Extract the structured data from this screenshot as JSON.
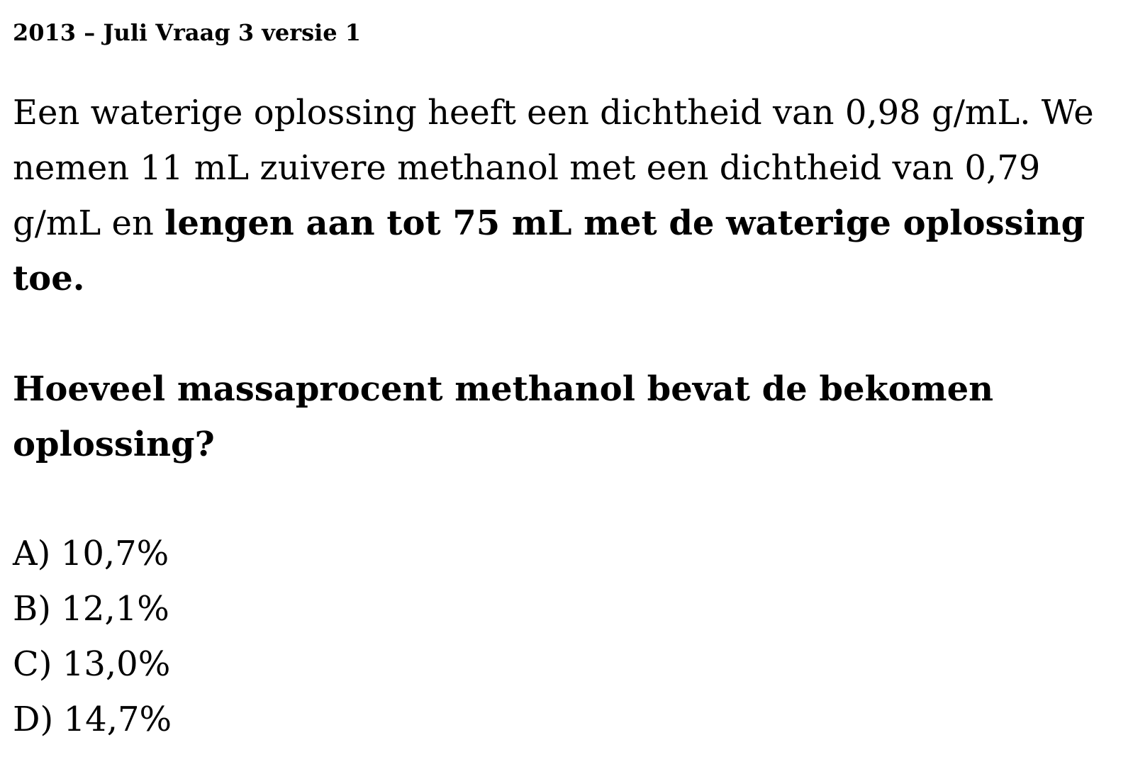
{
  "header": {
    "title": "2013 – Juli Vraag 3 versie 1"
  },
  "problem": {
    "text_plain": "Een waterige oplossing heeft een dichtheid van 0,98 g/mL. We nemen 11 mL zuivere methanol met een dichtheid van 0,79 g/mL en ",
    "text_bold": "lengen aan tot 75 mL met de waterige oplossing toe."
  },
  "question": {
    "text": "Hoeveel massaprocent methanol bevat de bekomen oplossing?"
  },
  "options": [
    {
      "letter": "A)",
      "value": "10,7%"
    },
    {
      "letter": "B)",
      "value": "12,1%"
    },
    {
      "letter": "C)",
      "value": "13,0%"
    },
    {
      "letter": "D)",
      "value": "14,7%"
    }
  ]
}
